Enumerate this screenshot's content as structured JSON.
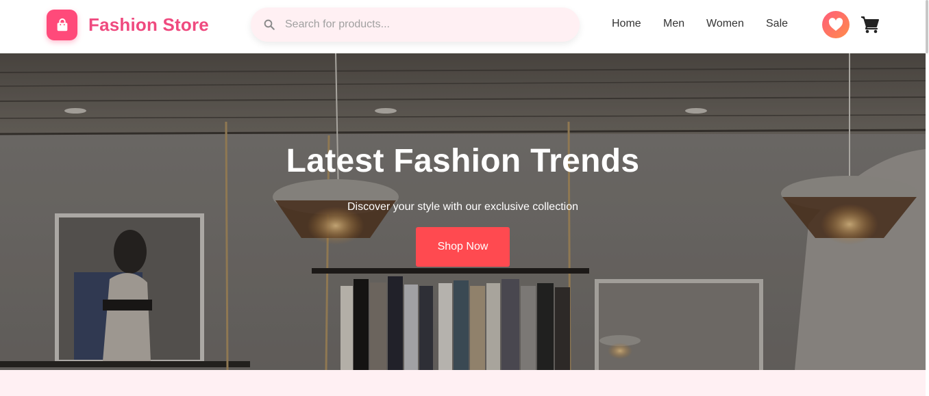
{
  "header": {
    "brand_name": "Fashion Store",
    "brand_icon": "shopping-bag-icon",
    "search_placeholder": "Search for products...",
    "nav": {
      "home": "Home",
      "men": "Men",
      "women": "Women",
      "sale": "Sale"
    },
    "wishlist_icon": "heart-icon",
    "cart_icon": "cart-icon"
  },
  "hero": {
    "title": "Latest Fashion Trends",
    "subtitle": "Discover your style with our exclusive collection",
    "cta_label": "Shop Now"
  },
  "colors": {
    "brand": "#ef4a7f",
    "brand_icon_bg": "#ff4a7a",
    "search_bg": "#fff0f3",
    "cta": "#ff4a50",
    "section_bg": "#fff0f3"
  }
}
